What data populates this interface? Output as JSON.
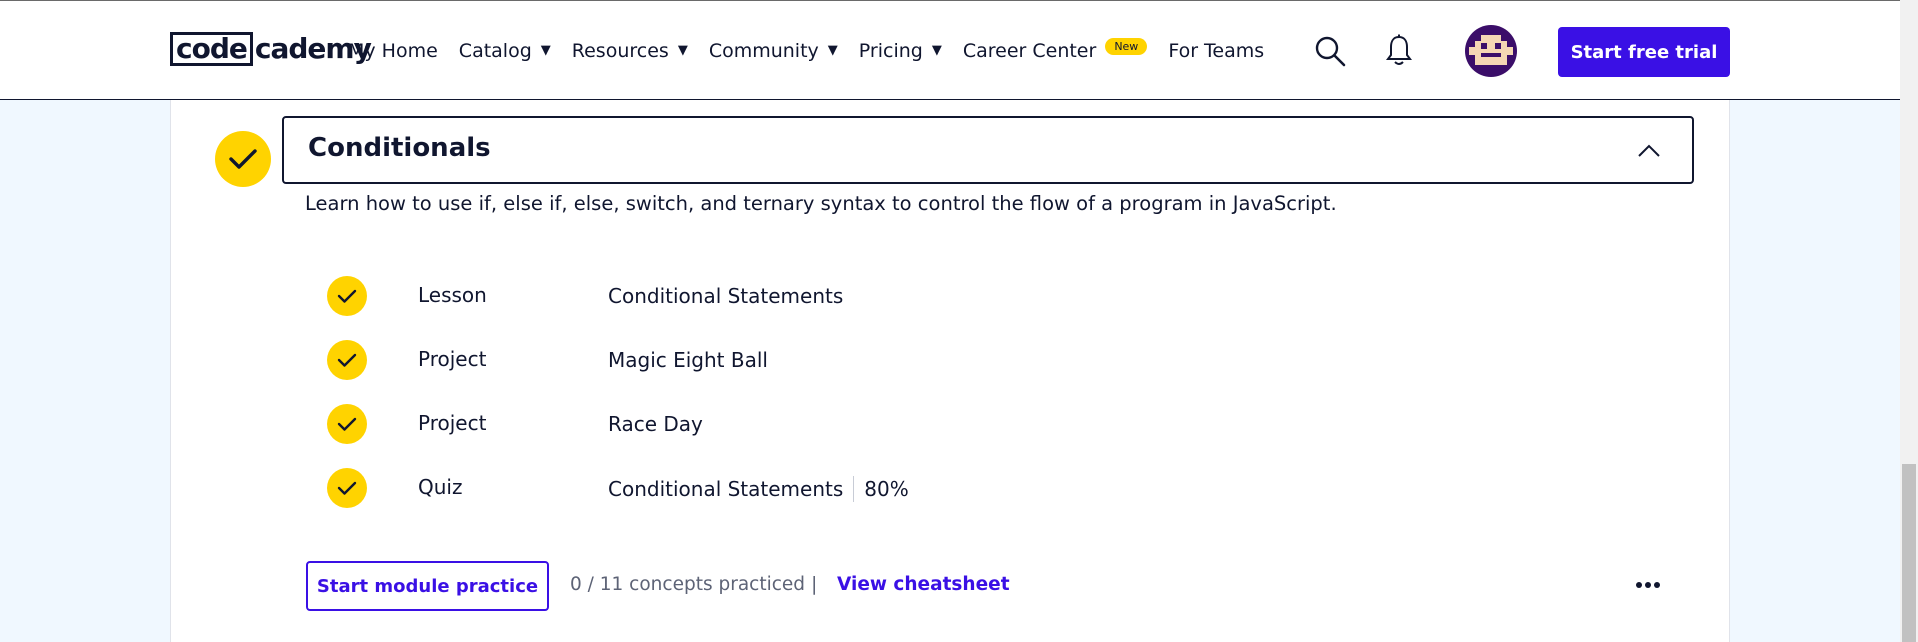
{
  "header": {
    "logo": {
      "boxed": "code",
      "rest": "cademy"
    },
    "nav": [
      {
        "label": "My Home",
        "caret": false
      },
      {
        "label": "Catalog",
        "caret": true
      },
      {
        "label": "Resources",
        "caret": true
      },
      {
        "label": "Community",
        "caret": true
      },
      {
        "label": "Pricing",
        "caret": true
      },
      {
        "label": "Career Center",
        "caret": false,
        "badge": "New"
      },
      {
        "label": "For Teams",
        "caret": false
      }
    ],
    "icons": [
      "search-icon",
      "bell-icon",
      "avatar"
    ],
    "cta_label": "Start free trial",
    "accent_color": "#3a10e5",
    "badge_color": "#ffd300"
  },
  "module": {
    "title": "Conditionals",
    "description": "Learn how to use if, else if, else, switch, and ternary syntax to control the flow of a program in JavaScript.",
    "completed": true,
    "items": [
      {
        "type": "Lesson",
        "title": "Conditional Statements",
        "completed": true,
        "score": ""
      },
      {
        "type": "Project",
        "title": "Magic Eight Ball",
        "completed": true,
        "score": ""
      },
      {
        "type": "Project",
        "title": "Race Day",
        "completed": true,
        "score": ""
      },
      {
        "type": "Quiz",
        "title": "Conditional Statements",
        "completed": true,
        "score": "80%"
      }
    ],
    "practice_button": "Start module practice",
    "practiced_text": "0 / 11 concepts practiced",
    "separator": "|",
    "cheatsheet_link": "View cheatsheet"
  }
}
